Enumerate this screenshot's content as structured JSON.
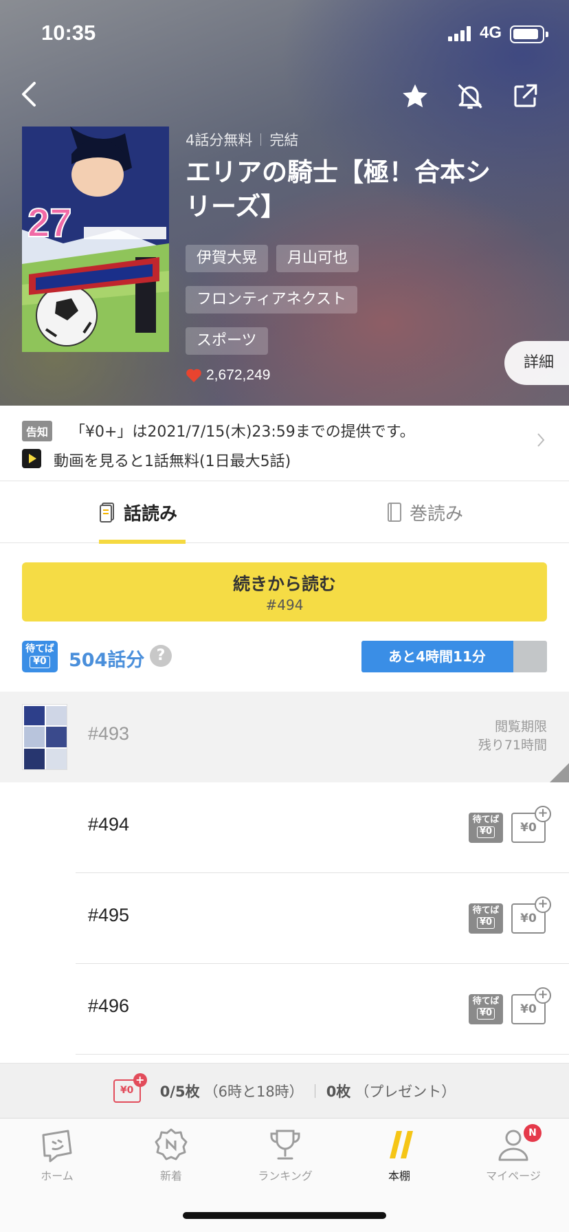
{
  "status_bar": {
    "time": "10:35",
    "network": "4G"
  },
  "colors": {
    "accent_yellow": "#f5d940",
    "accent_blue": "#3a8ee6",
    "badge_red": "#e5394a",
    "ticket_red": "#e24c5b"
  },
  "header": {
    "back_icon": "chevron-left-icon",
    "actions": [
      "star-icon",
      "bell-off-icon",
      "share-icon"
    ]
  },
  "work": {
    "free_info": "4話分無料",
    "status": "完結",
    "title": "エリアの騎士【極！合本シリーズ】",
    "tags": [
      "伊賀大晃",
      "月山可也",
      "フロンティアネクスト",
      "スポーツ"
    ],
    "likes": "2,672,249",
    "detail_label": "詳細"
  },
  "cover": {
    "volume_number": "27"
  },
  "notice": {
    "badge": "告知",
    "line1": "「¥0+」は2021/7/15(木)23:59までの提供です。",
    "line2": "動画を見ると1話無料(1日最大5話)"
  },
  "tabs": {
    "episode": "話読み",
    "volume": "巻読み"
  },
  "continue": {
    "label": "続きから読む",
    "sub": "#494"
  },
  "wait_free": {
    "badge_top": "待てば",
    "badge_bottom": "¥0",
    "episodes": "504話分",
    "help": "?",
    "timer": "あと4時間11分",
    "timer_progress": 0.82
  },
  "episodes": [
    {
      "number": "#493",
      "expire_label": "閲覧期限",
      "expire_remaining": "残り71時間"
    },
    {
      "number": "#494",
      "wait_top": "待てば",
      "wait_bottom": "¥0",
      "zero": "¥0",
      "plus": "+"
    },
    {
      "number": "#495",
      "wait_top": "待てば",
      "wait_bottom": "¥0",
      "zero": "¥0",
      "plus": "+"
    },
    {
      "number": "#496",
      "wait_top": "待てば",
      "wait_bottom": "¥0",
      "zero": "¥0",
      "plus": "+"
    }
  ],
  "ticket_bar": {
    "icon_label": "¥0",
    "icon_plus": "+",
    "count": "0/5枚",
    "times": "（6時と18時）",
    "present_count": "0枚",
    "present_label": "（プレゼント）"
  },
  "nav": {
    "items": [
      {
        "label": "ホーム",
        "icon": "home-icon"
      },
      {
        "label": "新着",
        "icon": "new-icon"
      },
      {
        "label": "ランキング",
        "icon": "trophy-icon"
      },
      {
        "label": "本棚",
        "icon": "bookshelf-icon"
      },
      {
        "label": "マイページ",
        "icon": "person-icon",
        "badge": "N"
      }
    ]
  }
}
